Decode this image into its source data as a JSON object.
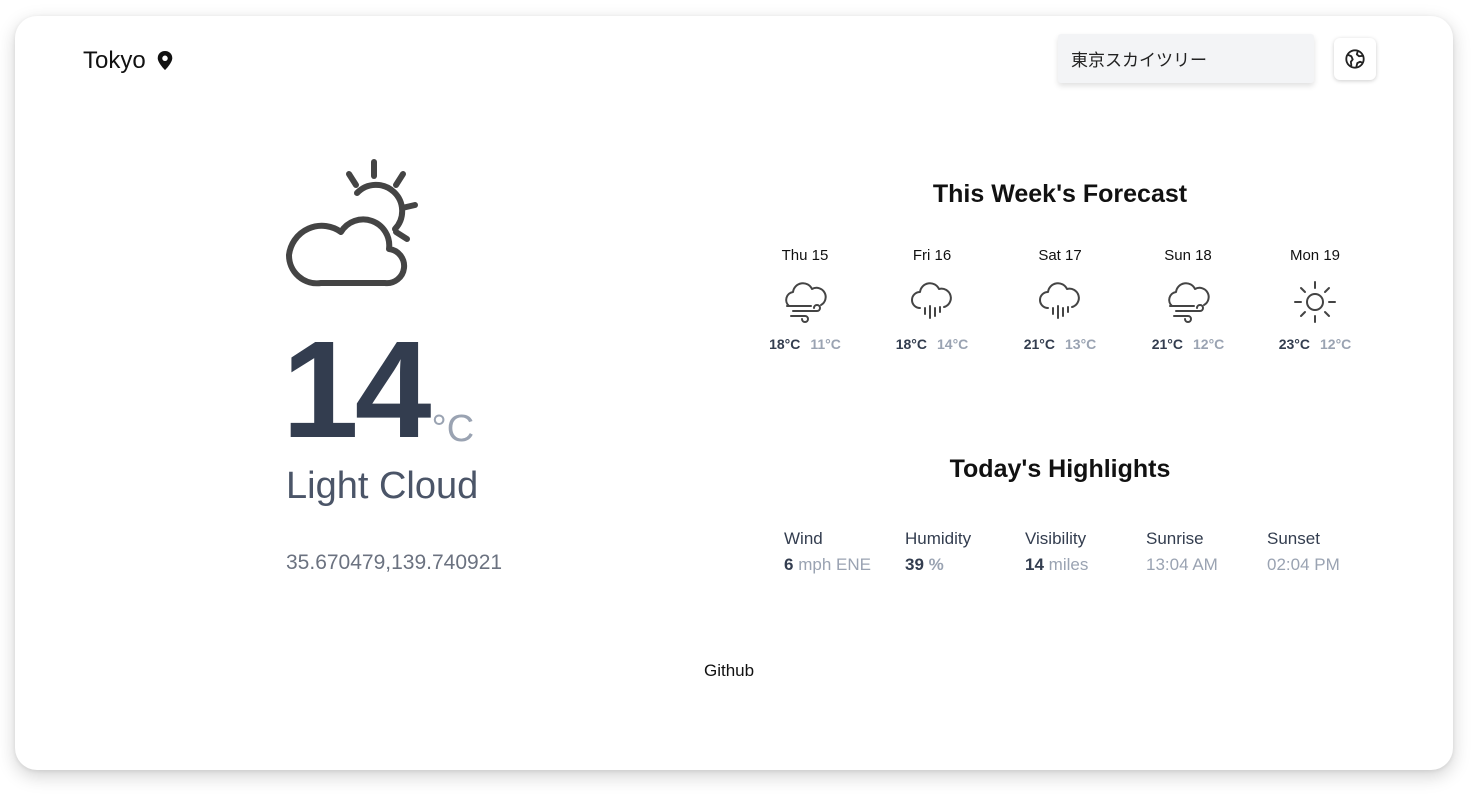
{
  "header": {
    "city": "Tokyo",
    "search_value": "東京スカイツリー"
  },
  "current": {
    "icon": "partly-cloudy-icon",
    "temperature": "14",
    "unit": "°C",
    "condition": "Light Cloud",
    "coordinates": "35.670479,139.740921"
  },
  "forecast": {
    "title": "This Week's Forecast",
    "days": [
      {
        "day": "Thu 15",
        "icon": "cloud-wind-icon",
        "high": "18°C",
        "low": "11°C"
      },
      {
        "day": "Fri 16",
        "icon": "cloud-rain-icon",
        "high": "18°C",
        "low": "14°C"
      },
      {
        "day": "Sat 17",
        "icon": "cloud-rain-icon",
        "high": "21°C",
        "low": "13°C"
      },
      {
        "day": "Sun 18",
        "icon": "cloud-wind-icon",
        "high": "21°C",
        "low": "12°C"
      },
      {
        "day": "Mon 19",
        "icon": "sun-icon",
        "high": "23°C",
        "low": "12°C"
      }
    ]
  },
  "highlights": {
    "title": "Today's Highlights",
    "wind": {
      "label": "Wind",
      "value": "6",
      "unit": "mph ENE"
    },
    "humidity": {
      "label": "Humidity",
      "value": "39",
      "unit": "%"
    },
    "visibility": {
      "label": "Visibility",
      "value": "14",
      "unit": "miles"
    },
    "sunrise": {
      "label": "Sunrise",
      "value": "13:04 AM"
    },
    "sunset": {
      "label": "Sunset",
      "value": "02:04 PM"
    }
  },
  "footer": {
    "link": "Github"
  }
}
